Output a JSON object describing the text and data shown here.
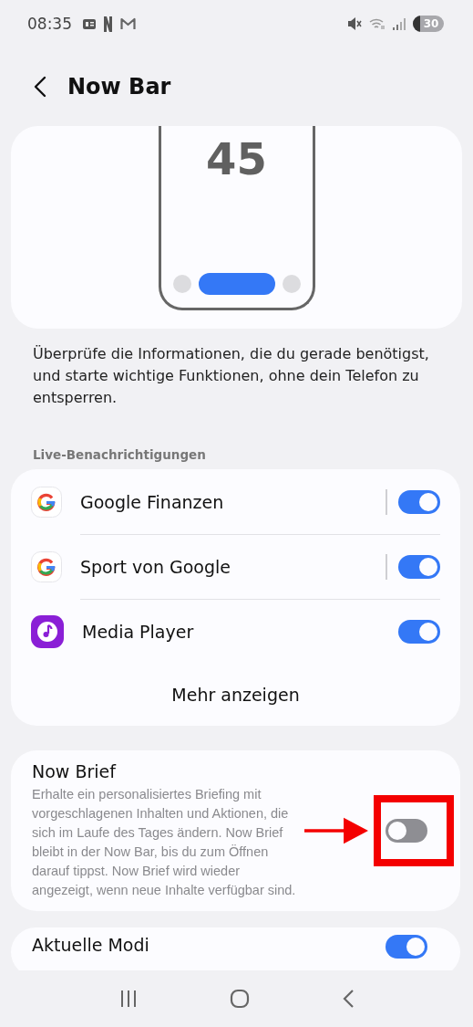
{
  "status_bar": {
    "time": "08:35",
    "battery": "30"
  },
  "header": {
    "title": "Now Bar"
  },
  "preview": {
    "clock": "45"
  },
  "description": "Überprüfe die Informationen, die du gerade benötigst, und starte wichtige Funktionen, ohne dein Telefon zu entsperren.",
  "live_section": {
    "heading": "Live-Benachrichtigungen",
    "items": [
      {
        "kind": "google",
        "label": "Google Finanzen",
        "split": true,
        "on": true
      },
      {
        "kind": "google",
        "label": "Sport von Google",
        "split": true,
        "on": true
      },
      {
        "kind": "media",
        "label": "Media Player",
        "split": false,
        "on": true
      }
    ],
    "more": "Mehr anzeigen"
  },
  "now_brief": {
    "title": "Now Brief",
    "summary": "Erhalte ein personalisiertes Briefing mit vorgeschlagenen Inhalten und Aktionen, die sich im Laufe des Tages ändern. Now Brief bleibt in der Now Bar, bis du zum Öffnen darauf tippst. Now Brief wird wieder angezeigt, wenn neue Inhalte verfügbar sind.",
    "on": false
  },
  "next_card": {
    "title": "Aktuelle Modi",
    "on": true
  }
}
